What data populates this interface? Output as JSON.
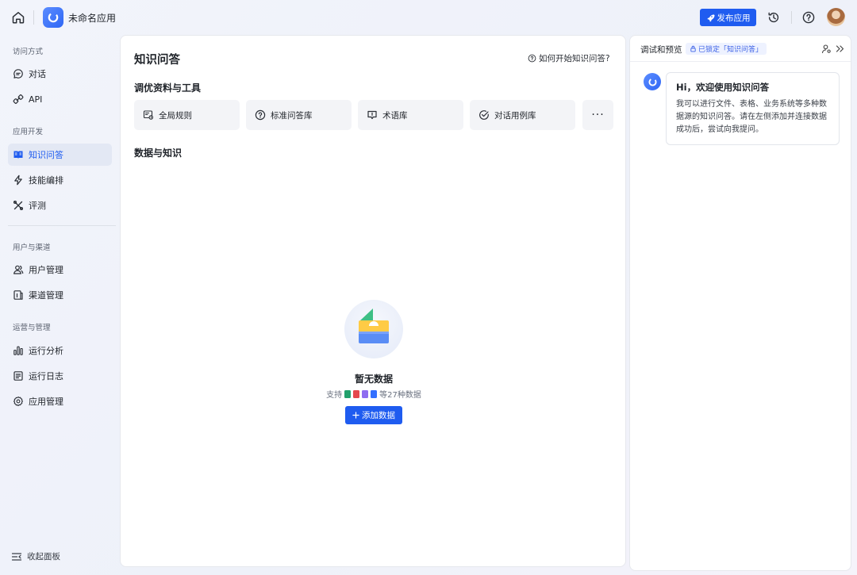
{
  "header": {
    "app_name": "未命名应用",
    "publish_label": "发布应用"
  },
  "sidebar": {
    "sections": [
      {
        "title": "访问方式",
        "items": [
          {
            "label": "对话",
            "icon": "chat-icon"
          },
          {
            "label": "API",
            "icon": "api-icon"
          }
        ]
      },
      {
        "title": "应用开发",
        "items": [
          {
            "label": "知识问答",
            "icon": "book-icon",
            "active": true
          },
          {
            "label": "技能编排",
            "icon": "bolt-icon"
          },
          {
            "label": "评测",
            "icon": "evaluate-icon"
          }
        ]
      },
      {
        "title": "用户与渠道",
        "items": [
          {
            "label": "用户管理",
            "icon": "users-icon"
          },
          {
            "label": "渠道管理",
            "icon": "channel-icon"
          }
        ]
      },
      {
        "title": "运营与管理",
        "items": [
          {
            "label": "运行分析",
            "icon": "bar-chart-icon"
          },
          {
            "label": "运行日志",
            "icon": "log-icon"
          },
          {
            "label": "应用管理",
            "icon": "gear-icon"
          }
        ]
      }
    ],
    "collapse_label": "收起面板"
  },
  "main": {
    "title": "知识问答",
    "help_link": "如何开始知识问答?",
    "tools_heading": "调优资料与工具",
    "tools": [
      {
        "label": "全局规则",
        "icon": "rules-icon"
      },
      {
        "label": "标准问答库",
        "icon": "question-icon"
      },
      {
        "label": "术语库",
        "icon": "glossary-icon"
      },
      {
        "label": "对话用例库",
        "icon": "check-circle-icon"
      }
    ],
    "more_label": "···",
    "data_heading": "数据与知识",
    "empty": {
      "title": "暂无数据",
      "support_prefix": "支持",
      "support_suffix": "等27种数据",
      "file_type_colors": [
        "#22a06b",
        "#e5484d",
        "#8e6cf0",
        "#3370ff"
      ],
      "add_label": "添加数据"
    }
  },
  "preview": {
    "title": "调试和预览",
    "lock_badge": "已锁定「知识问答」",
    "message": {
      "title": "Hi，欢迎使用知识问答",
      "body": "我可以进行文件、表格、业务系统等多种数据源的知识问答。请在左侧添加并连接数据成功后，尝试向我提问。"
    }
  }
}
